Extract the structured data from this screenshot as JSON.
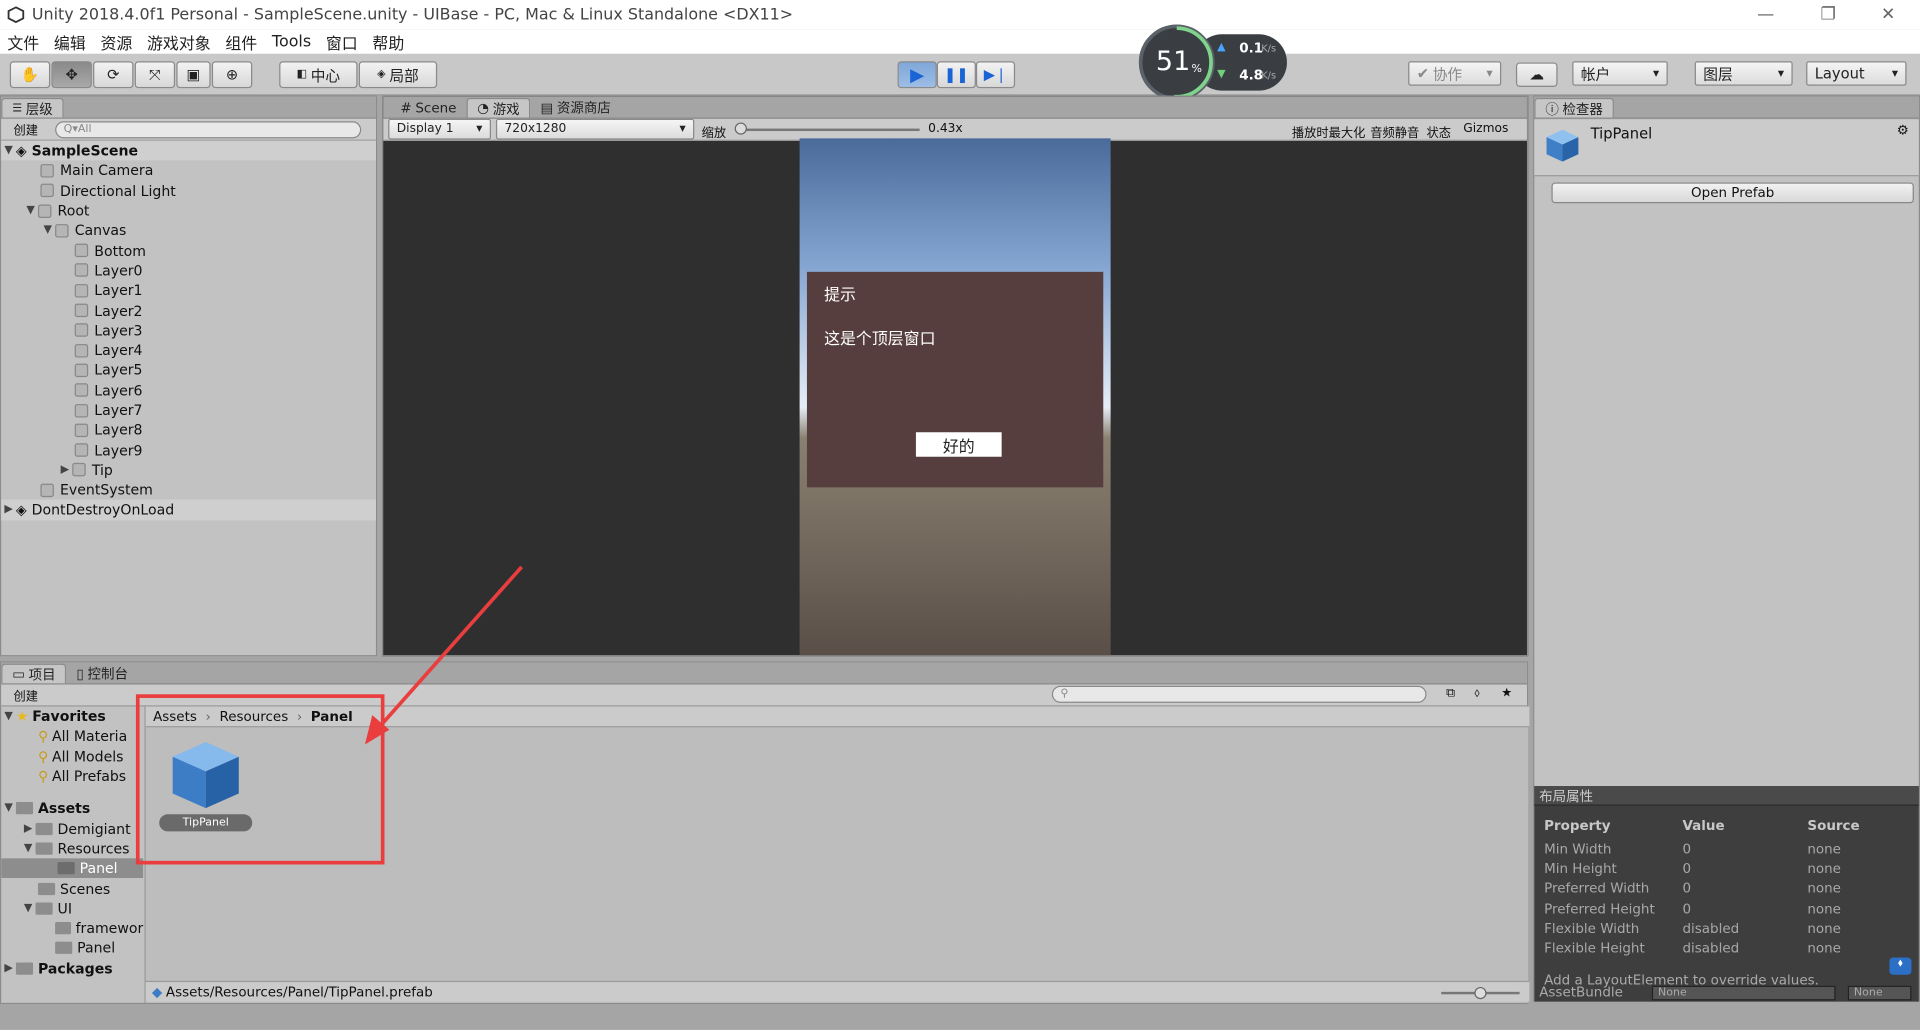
{
  "window": {
    "title": "Unity 2018.4.0f1 Personal - SampleScene.unity - UIBase - PC, Mac & Linux Standalone <DX11>",
    "min": "—",
    "max": "❐",
    "close": "✕"
  },
  "menu": [
    "文件",
    "编辑",
    "资源",
    "游戏对象",
    "组件",
    "Tools",
    "窗口",
    "帮助"
  ],
  "toolbar": {
    "center": "中心",
    "local": "局部",
    "collab": "协作",
    "account": "帐户",
    "layers": "图层",
    "layout": "Layout"
  },
  "perf": {
    "percent": "51",
    "unit": "%",
    "up": "0.1",
    "down": "4.8",
    "rate": "K/s"
  },
  "hierarchy": {
    "tab": "层级",
    "create": "创建",
    "search": "Q▾All",
    "scene": "SampleScene",
    "items": [
      "Main Camera",
      "Directional Light",
      "Root",
      "Canvas",
      "Bottom",
      "Layer0",
      "Layer1",
      "Layer2",
      "Layer3",
      "Layer4",
      "Layer5",
      "Layer6",
      "Layer7",
      "Layer8",
      "Layer9",
      "Tip",
      "EventSystem"
    ],
    "ddol": "DontDestroyOnLoad"
  },
  "game": {
    "tabs": [
      "Scene",
      "游戏",
      "资源商店"
    ],
    "display": "Display 1",
    "resolution": "720x1280",
    "scale_label": "缩放",
    "scale": "0.43x",
    "maximize": "播放时最大化",
    "mute": "音频静音",
    "stats": "状态",
    "gizmos": "Gizmos",
    "dialog_title": "提示",
    "dialog_text": "这是个顶层窗口",
    "ok": "好的"
  },
  "inspector": {
    "tab": "检查器",
    "object": "TipPanel",
    "open_prefab": "Open Prefab",
    "layout_title": "布局属性",
    "headers": [
      "Property",
      "Value",
      "Source"
    ],
    "rows": [
      [
        "Min Width",
        "0",
        "none"
      ],
      [
        "Min Height",
        "0",
        "none"
      ],
      [
        "Preferred Width",
        "0",
        "none"
      ],
      [
        "Preferred Height",
        "0",
        "none"
      ],
      [
        "Flexible Width",
        "disabled",
        "none"
      ],
      [
        "Flexible Height",
        "disabled",
        "none"
      ]
    ],
    "hint": "Add a LayoutElement to override values.",
    "assetbundle": "AssetBundle",
    "none1": "None",
    "none2": "None"
  },
  "project": {
    "tabs": [
      "项目",
      "控制台"
    ],
    "create": "创建",
    "favorites": "Favorites",
    "fav_items": [
      "All Materia",
      "All Models",
      "All Prefabs"
    ],
    "assets": "Assets",
    "tree": [
      "Demigiant",
      "Resources",
      "Panel",
      "Scenes",
      "UI",
      "framewor",
      "Panel"
    ],
    "packages": "Packages",
    "breadcrumb": [
      "Assets",
      "Resources",
      "Panel"
    ],
    "asset": "TipPanel",
    "path": "Assets/Resources/Panel/TipPanel.prefab"
  }
}
